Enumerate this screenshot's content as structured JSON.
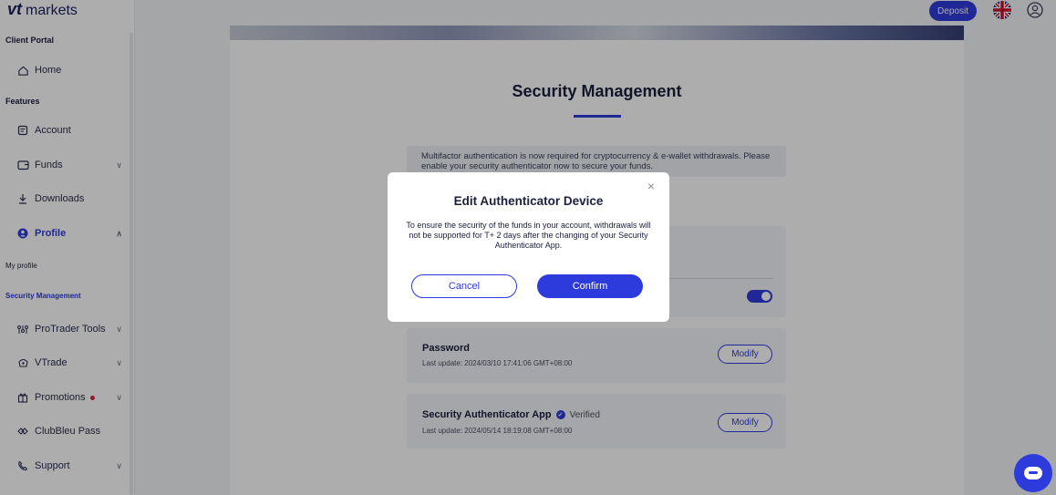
{
  "brand": {
    "logo_main": "vt",
    "logo_sub": "markets"
  },
  "header": {
    "deposit_label": "Deposit"
  },
  "sidebar": {
    "section_client": "Client Portal",
    "section_features": "Features",
    "items": [
      {
        "label": "Home",
        "icon": "home-icon"
      },
      {
        "label": "Account",
        "icon": "document-icon"
      },
      {
        "label": "Funds",
        "icon": "wallet-icon"
      },
      {
        "label": "Downloads",
        "icon": "download-icon"
      },
      {
        "label": "Profile",
        "icon": "user-icon"
      },
      {
        "label": "ProTrader Tools",
        "icon": "tools-icon"
      },
      {
        "label": "VTrade",
        "icon": "vtrade-icon"
      },
      {
        "label": "Promotions",
        "icon": "gift-icon"
      },
      {
        "label": "ClubBleu Pass",
        "icon": "pass-icon"
      },
      {
        "label": "Support",
        "icon": "support-icon"
      }
    ],
    "sub_items": [
      {
        "label": "My profile"
      },
      {
        "label": "Security Management"
      }
    ]
  },
  "main": {
    "title": "Security Management",
    "notice": "Multifactor authentication is now required for cryptocurrency & e-wallet withdrawals. Please enable your security authenticator now to secure your funds.",
    "password": {
      "title": "Password",
      "last_update": "Last update: 2024/03/10 17:41:06 GMT+08:00",
      "button": "Modify"
    },
    "authenticator": {
      "title": "Security Authenticator App",
      "status": "Verified",
      "last_update": "Last update: 2024/05/14 18:19:08 GMT+08:00",
      "button": "Modify"
    }
  },
  "modal": {
    "title": "Edit Authenticator Device",
    "body": "To ensure the security of the funds in your account, withdrawals will not be supported for T+ 2 days after the changing of your Security Authenticator App.",
    "cancel_label": "Cancel",
    "confirm_label": "Confirm",
    "close_glyph": "×"
  },
  "colors": {
    "accent": "#2e3bdc",
    "alert": "#e0243c"
  }
}
